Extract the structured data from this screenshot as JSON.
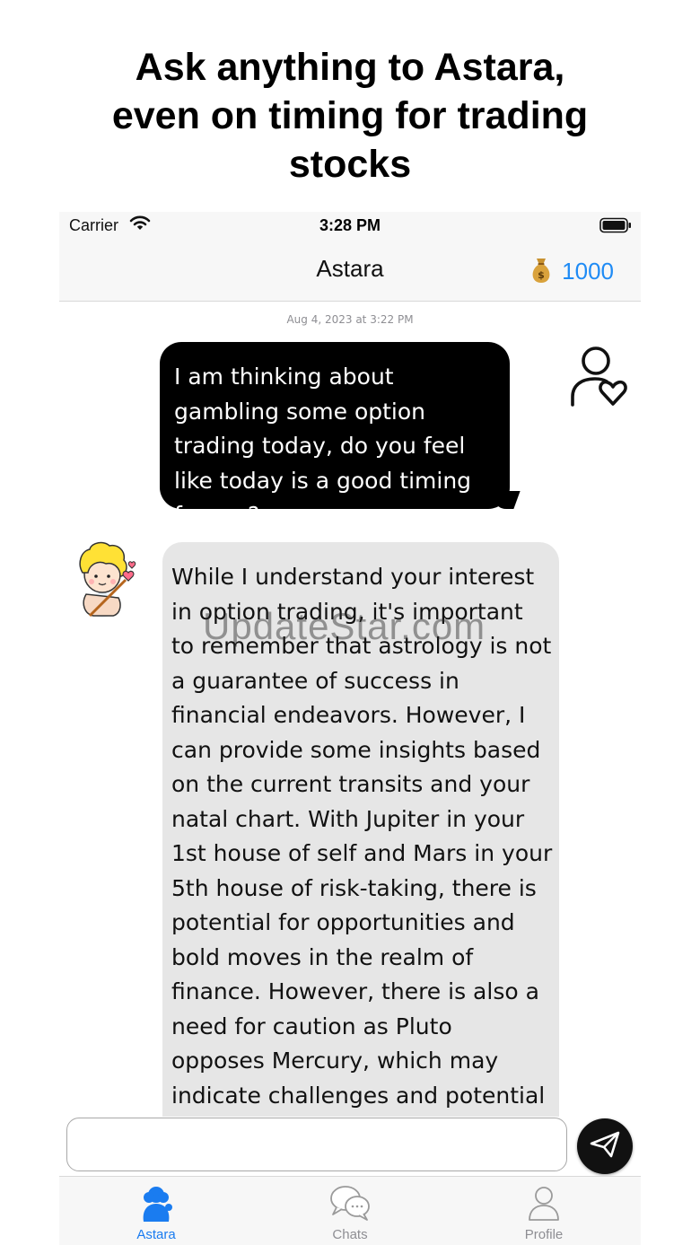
{
  "headline": {
    "line1": "Ask anything to Astara,",
    "line2": "even on timing for trading",
    "line3": "stocks"
  },
  "status_bar": {
    "carrier": "Carrier",
    "time": "3:28 PM"
  },
  "nav": {
    "title": "Astara",
    "coins": "1000",
    "coin_icon": "money-bag-icon"
  },
  "chat": {
    "timestamp": "Aug 4, 2023 at 3:22 PM",
    "user_message": "I am thinking about gambling some option trading today, do you feel like today is a good timing for me?",
    "bot_lines": [
      "While I understand your interest",
      "in option trading, it's important",
      "to remember that astrology is not",
      "a guarantee of success in",
      "financial endeavors. However, I",
      "can provide some insights based",
      "on the current transits and your",
      "natal chart. With Jupiter in your",
      "1st house of self and Mars in your",
      "5th house of risk-taking, there is",
      "potential for opportunities and",
      "bold moves in the realm of",
      "finance. However, there is also a",
      "need for caution as Pluto",
      "opposes Mercury, which may",
      "indicate challenges and potential"
    ],
    "watermark": "UpdateStar.com"
  },
  "composer": {
    "value": "",
    "placeholder": ""
  },
  "tabs": [
    {
      "label": "Astara",
      "icon": "astara-tab-icon",
      "active": true
    },
    {
      "label": "Chats",
      "icon": "chat-bubbles-icon",
      "active": false
    },
    {
      "label": "Profile",
      "icon": "profile-icon",
      "active": false
    }
  ],
  "colors": {
    "accent": "#1a7cf0",
    "coins": "#1f8bf5",
    "user_bubble": "#000000",
    "bot_bubble": "#e6e6e6"
  }
}
